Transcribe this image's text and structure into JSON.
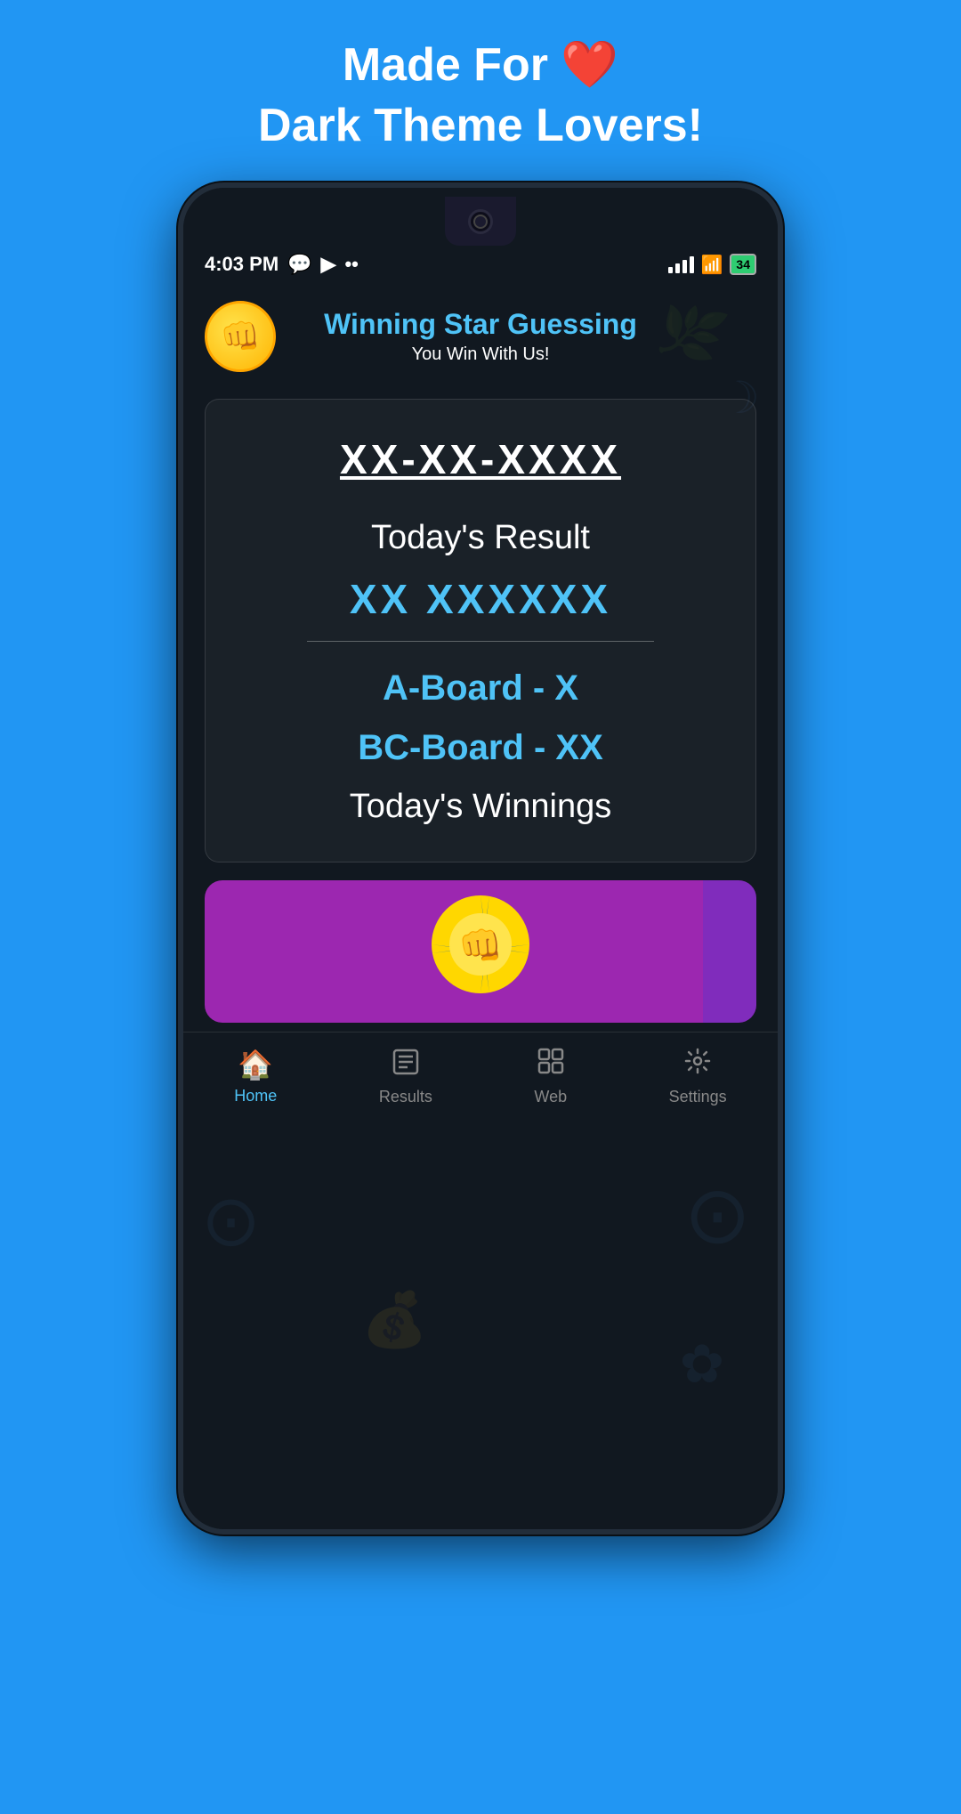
{
  "page": {
    "background_color": "#2196F3",
    "top_heading_line1": "Made For ❤️",
    "top_heading_line2": "Dark Theme Lovers!"
  },
  "status_bar": {
    "time": "4:03 PM",
    "battery": "34",
    "signal_full": true
  },
  "app": {
    "logo_emoji": "👊",
    "title": "Winning Star Guessing",
    "subtitle": "You Win With Us!"
  },
  "card": {
    "ticket_number": "XX-XX-XXXX",
    "result_label": "Today's Result",
    "result_value": "XX XXXXXX",
    "a_board": "A-Board - X",
    "bc_board": "BC-Board - XX",
    "winnings_label": "Today's Winnings"
  },
  "bottom_nav": {
    "items": [
      {
        "label": "Home",
        "icon": "🏠",
        "active": true
      },
      {
        "label": "Results",
        "icon": "📋",
        "active": false
      },
      {
        "label": "Web",
        "icon": "⊞",
        "active": false
      },
      {
        "label": "Settings",
        "icon": "⚙️",
        "active": false
      }
    ]
  }
}
